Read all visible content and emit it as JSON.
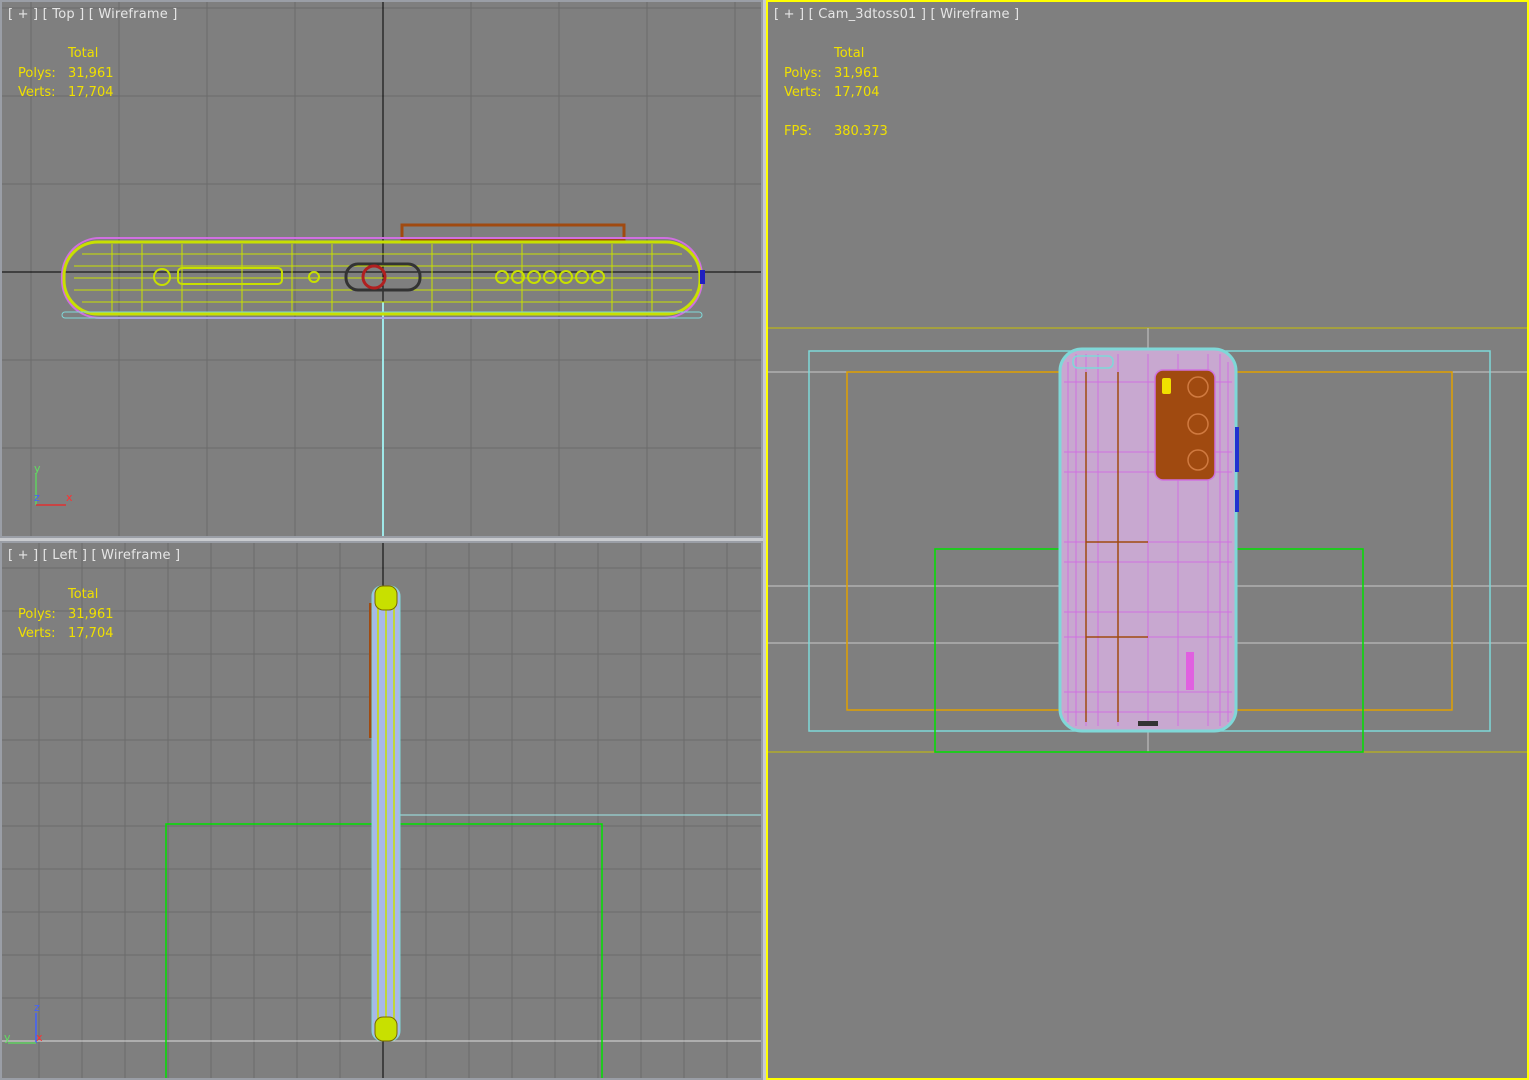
{
  "viewports": {
    "top": {
      "label": {
        "plus": "[ + ]",
        "view": "[ Top ]",
        "shading": "[ Wireframe ]"
      },
      "stats": {
        "header": "Total",
        "polys_label": "Polys:",
        "polys": "31,961",
        "verts_label": "Verts:",
        "verts": "17,704"
      },
      "axis": {
        "first": "y",
        "second": "z",
        "third": "x"
      }
    },
    "left": {
      "label": {
        "plus": "[ + ]",
        "view": "[ Left ]",
        "shading": "[ Wireframe ]"
      },
      "stats": {
        "header": "Total",
        "polys_label": "Polys:",
        "polys": "31,961",
        "verts_label": "Verts:",
        "verts": "17,704"
      },
      "axis": {
        "first": "z",
        "second": "y",
        "third": "x"
      }
    },
    "camera": {
      "label": {
        "plus": "[ + ]",
        "view": "[ Cam_3dtoss01 ]",
        "shading": "[ Wireframe ]"
      },
      "active": true,
      "stats": {
        "header": "Total",
        "polys_label": "Polys:",
        "polys": "31,961",
        "verts_label": "Verts:",
        "verts": "17,704",
        "fps_label": "FPS:",
        "fps": "380.373"
      }
    }
  },
  "colors": {
    "viewport_bg": "#7f7f7f",
    "grid_line": "#6b6b6b",
    "active_border": "#ffff00",
    "inactive_border": "#9a9ea6",
    "stats_text": "#f0e000",
    "label_text": "#e6e6e6",
    "wire_yellow": "#c8e000",
    "wire_magenta": "#d070e0",
    "wire_cyan": "#7fd8d8",
    "wire_brown": "#a04a10",
    "light_green": "#00e000",
    "light_orange": "#e0a000"
  }
}
